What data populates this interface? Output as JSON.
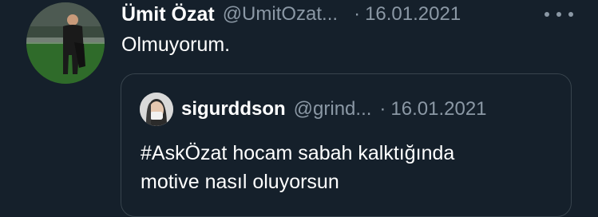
{
  "tweet": {
    "author_name": "Ümit Özat",
    "author_handle": "@UmitOzat...",
    "separator": "·",
    "date": "16.01.2021",
    "text": "Olmuyorum.",
    "avatar_icon": "profile-photo",
    "more_icon": "more-options-icon"
  },
  "quoted_tweet": {
    "author_name": "sigurddson",
    "author_handle": "@grind...",
    "separator": "·",
    "date": "16.01.2021",
    "text_lines": [
      "#AskÖzat hocam sabah kalktığında",
      "motive nasıl oluyorsun"
    ],
    "avatar_icon": "profile-photo"
  },
  "colors": {
    "background": "#15202b",
    "primary_text": "#ffffff",
    "secondary_text": "#8b98a5",
    "border": "#38444d"
  }
}
